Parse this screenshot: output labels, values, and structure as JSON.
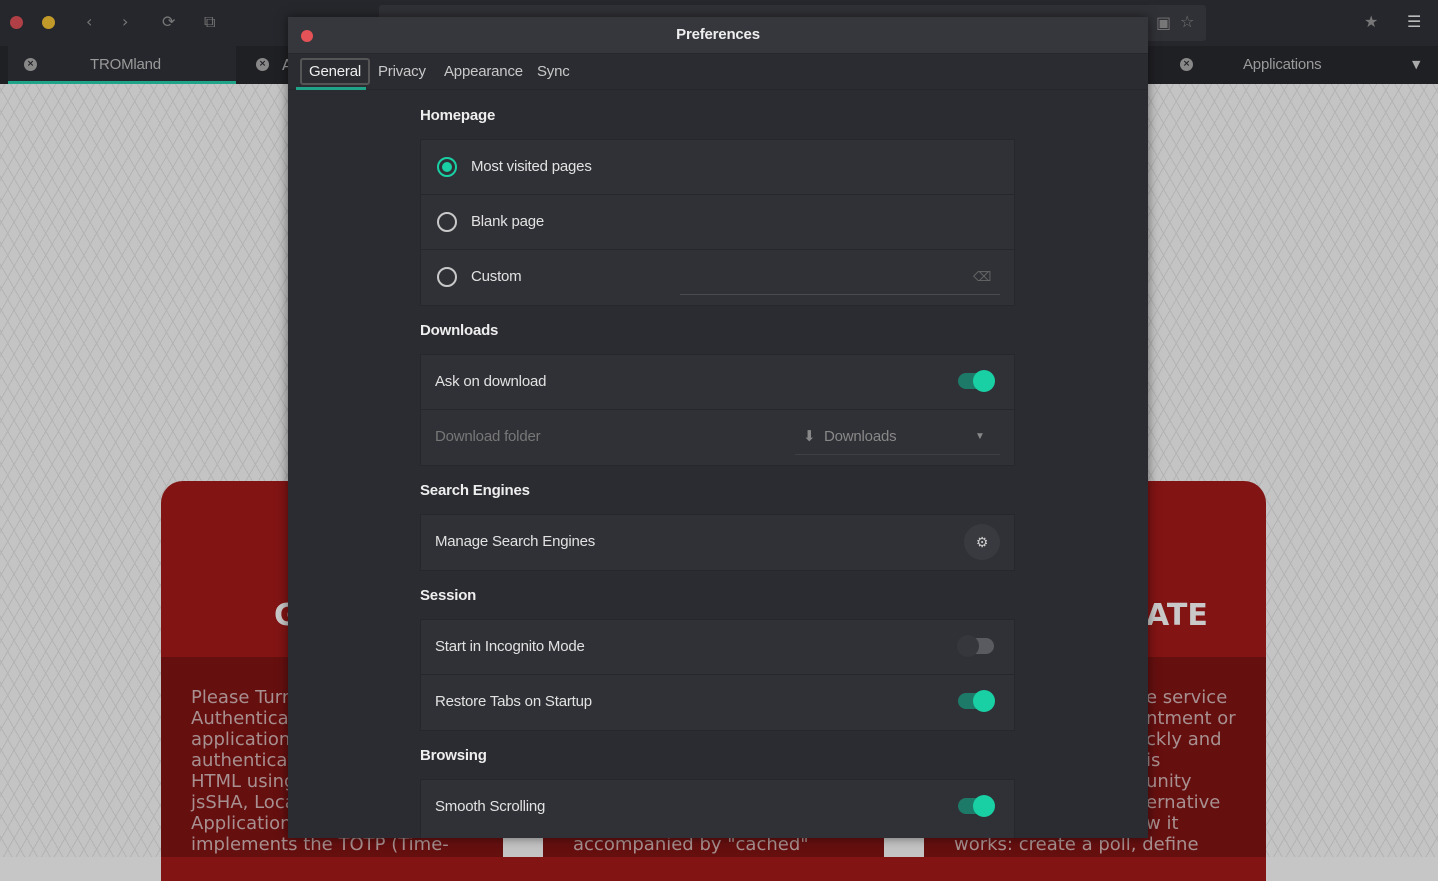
{
  "browser": {
    "tabs": [
      {
        "label": "TROMland",
        "active": true
      },
      {
        "label": "A",
        "active": false
      },
      {
        "label": "Applications",
        "active": false
      }
    ]
  },
  "page": {
    "heading_right": "ATE",
    "heading_left": "G",
    "col1": [
      "Please Turn",
      "Authentica",
      "application",
      "authenticat",
      "HTML using",
      "jsSHA, Loca",
      "Application",
      "implements the TOTP (Time-"
    ],
    "col2_last": "accompanied by \"cached\"",
    "col3": [
      "e service",
      "ntment or",
      "ckly and",
      "is",
      "unity",
      "ernative",
      "w it",
      "works: create a poll, define"
    ]
  },
  "dialog": {
    "title": "Preferences",
    "tabs": [
      "General",
      "Privacy",
      "Appearance",
      "Sync"
    ],
    "active_tab": "General",
    "homepage": {
      "title": "Homepage",
      "options": [
        "Most visited pages",
        "Blank page",
        "Custom"
      ],
      "selected": "Most visited pages",
      "custom_value": ""
    },
    "downloads": {
      "title": "Downloads",
      "ask_label": "Ask on download",
      "ask_on": true,
      "folder_label": "Download folder",
      "folder_value": "Downloads"
    },
    "search": {
      "title": "Search Engines",
      "manage_label": "Manage Search Engines"
    },
    "session": {
      "title": "Session",
      "incognito_label": "Start in Incognito Mode",
      "incognito_on": false,
      "restore_label": "Restore Tabs on Startup",
      "restore_on": true
    },
    "browsing": {
      "title": "Browsing",
      "smooth_label": "Smooth Scrolling",
      "smooth_on": true
    }
  },
  "colors": {
    "accent": "#19cfa4",
    "card": "#821414"
  }
}
